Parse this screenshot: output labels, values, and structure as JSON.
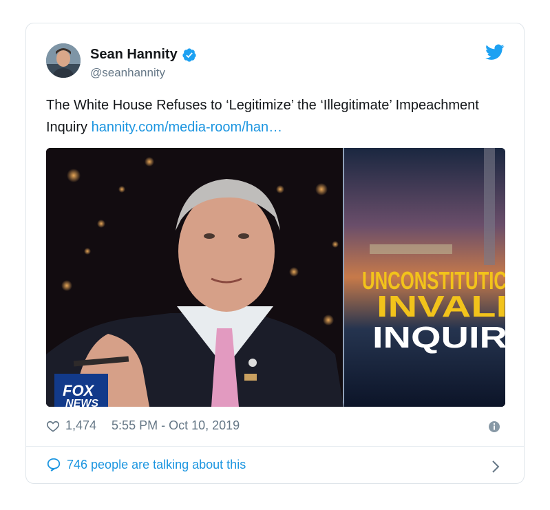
{
  "author": {
    "display_name": "Sean Hannity",
    "handle": "@seanhannity",
    "verified": true
  },
  "tweet": {
    "text": "The White House Refuses to ‘Legitimize’ the ‘Illegitimate’ Impeachment Inquiry",
    "link_text": "hannity.com/media-room/han…"
  },
  "media": {
    "chyron_line1": "UNCONSTITUTIC",
    "chyron_line2": "INVALI",
    "chyron_line3": "INQUIR",
    "logo_line1": "FOX",
    "logo_line2": "NEWS"
  },
  "meta": {
    "likes": "1,474",
    "timestamp": "5:55 PM - Oct 10, 2019"
  },
  "footer": {
    "talking_text": "746 people are talking about this"
  },
  "colors": {
    "link": "#1b95e0",
    "secondary": "#657786",
    "chyron_yellow": "#f2c31b"
  }
}
